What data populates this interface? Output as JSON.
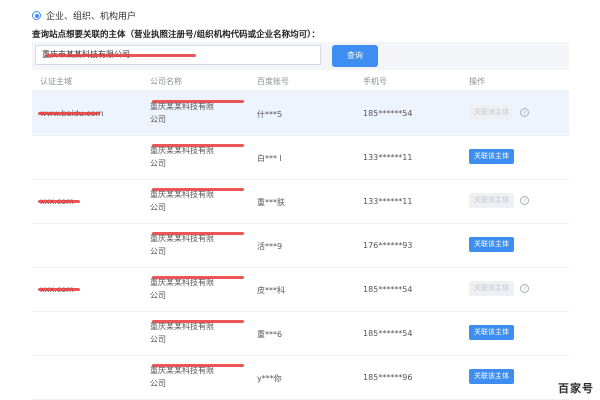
{
  "radio": {
    "label": "企业、组织、机构用户",
    "selected": true
  },
  "instruction": "查询站点想要关联的主体（营业执照注册号/组织机构代码或企业名称均可）：",
  "search": {
    "value": "重庆市某某科技有限公司",
    "button_label": "查询"
  },
  "table": {
    "headers": [
      "认证主域",
      "公司名称",
      "百度账号",
      "手机号",
      "操作"
    ],
    "rows": [
      {
        "domain": "www.baidu.com",
        "company_line1": "重庆某某科技有限",
        "company_line2": "公司",
        "account": "什***5",
        "phone": "185******54",
        "action": "关联该主体",
        "action_enabled": false,
        "help": true,
        "highlight": true
      },
      {
        "domain": "",
        "company_line1": "重庆某某科技有限",
        "company_line2": "公司",
        "account": "白*** l",
        "phone": "133******11",
        "action": "关联该主体",
        "action_enabled": true,
        "help": false,
        "highlight": false
      },
      {
        "domain": "xxx.com",
        "company_line1": "重庆某某科技有限",
        "company_line2": "公司",
        "account": "重***肤",
        "phone": "133******11",
        "action": "关联该主体",
        "action_enabled": false,
        "help": true,
        "highlight": false
      },
      {
        "domain": "",
        "company_line1": "重庆某某科技有限",
        "company_line2": "公司",
        "account": "活***9",
        "phone": "176******93",
        "action": "关联该主体",
        "action_enabled": true,
        "help": false,
        "highlight": false
      },
      {
        "domain": "xxx.com",
        "company_line1": "重庆某某科技有限",
        "company_line2": "公司",
        "account": "皮***科",
        "phone": "185******54",
        "action": "关联该主体",
        "action_enabled": false,
        "help": true,
        "highlight": false
      },
      {
        "domain": "",
        "company_line1": "重庆某某科技有限",
        "company_line2": "公司",
        "account": "重***6",
        "phone": "185******54",
        "action": "关联该主体",
        "action_enabled": true,
        "help": false,
        "highlight": false
      },
      {
        "domain": "",
        "company_line1": "重庆某某科技有限",
        "company_line2": "公司",
        "account": "y***你",
        "phone": "185******96",
        "action": "关联该主体",
        "action_enabled": true,
        "help": false,
        "highlight": false
      }
    ]
  },
  "watermark": "百家号",
  "colors": {
    "accent": "#3d8ef0",
    "redaction": "#e83a3a",
    "highlight_row": "#eef4fd"
  }
}
